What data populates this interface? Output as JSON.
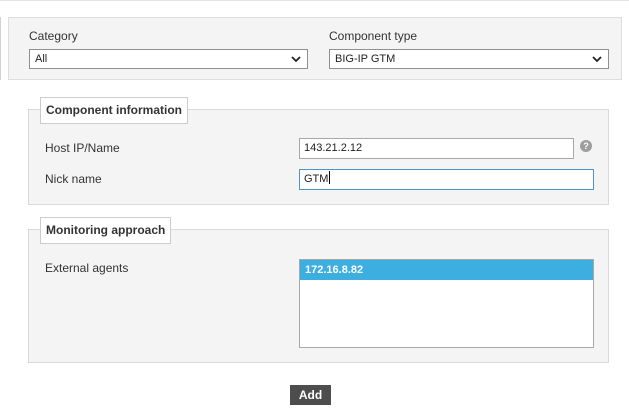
{
  "top": {
    "category": {
      "label": "Category",
      "value": "All"
    },
    "component_type": {
      "label": "Component type",
      "value": "BIG-IP GTM"
    }
  },
  "component_info": {
    "legend": "Component information",
    "host": {
      "label": "Host IP/Name",
      "value": "143.21.2.12",
      "help_glyph": "?"
    },
    "nick": {
      "label": "Nick name",
      "value": "GTM"
    }
  },
  "monitoring": {
    "legend": "Monitoring approach",
    "external_agents": {
      "label": "External agents",
      "items": [
        "172.16.8.82"
      ],
      "selected_index": 0
    }
  },
  "actions": {
    "add_label": "Add"
  },
  "icons": {
    "dropdown": "chevron-down-icon",
    "help": "help-icon"
  },
  "colors": {
    "selected_row": "#3daee0",
    "add_button": "#4d4d4d",
    "focus_border": "#4a98c0"
  }
}
